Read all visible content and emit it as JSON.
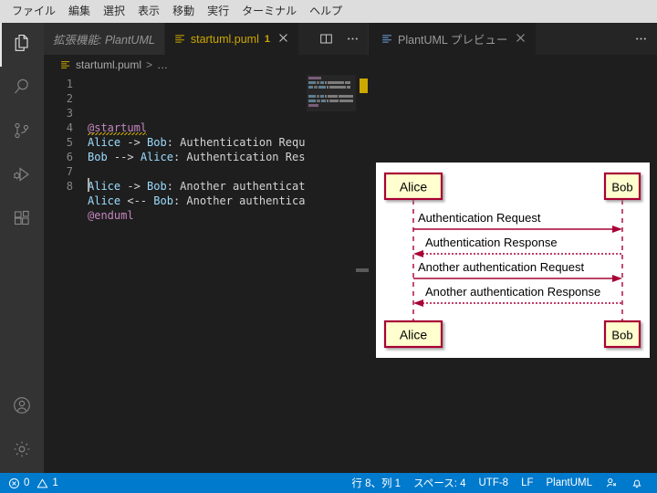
{
  "menu": {
    "items": [
      "ファイル",
      "編集",
      "選択",
      "表示",
      "移動",
      "実行",
      "ターミナル",
      "ヘルプ"
    ]
  },
  "activitybar": {
    "items": [
      {
        "name": "explorer",
        "icon": "files-icon",
        "active": true
      },
      {
        "name": "search",
        "icon": "search-icon",
        "active": false
      },
      {
        "name": "source-control",
        "icon": "source-control-icon",
        "active": false
      },
      {
        "name": "run-debug",
        "icon": "run-debug-icon",
        "active": false
      },
      {
        "name": "extensions",
        "icon": "extensions-icon",
        "active": false
      }
    ],
    "bottom": [
      {
        "name": "account",
        "icon": "account-icon"
      },
      {
        "name": "settings",
        "icon": "gear-icon"
      }
    ]
  },
  "editor_group_left": {
    "tabs": [
      {
        "label": "拡張機能: PlantUML",
        "icon": "extensions-tab-icon",
        "active": false,
        "italic": true,
        "badge": "",
        "closable": false
      },
      {
        "label": "startuml.puml",
        "icon": "file-lines-icon",
        "active": true,
        "italic": false,
        "badge": "1",
        "closable": true
      }
    ],
    "actions": [
      {
        "name": "split-editor-button",
        "icon": "split-editor-icon"
      },
      {
        "name": "more-actions-button",
        "icon": "ellipsis-icon"
      }
    ],
    "breadcrumb": {
      "file": "startuml.puml",
      "separator": ">",
      "tail": "…"
    }
  },
  "editor_group_right": {
    "tabs": [
      {
        "label": "PlantUML プレビュー",
        "icon": "file-lines-icon",
        "active": true,
        "italic": false,
        "badge": "",
        "closable": true
      }
    ],
    "actions": [
      {
        "name": "more-actions-button",
        "icon": "ellipsis-icon"
      }
    ]
  },
  "code": {
    "lines": [
      {
        "n": "1",
        "parts": [
          {
            "t": "@startuml",
            "c": "tok-pre",
            "squiggle": true
          }
        ]
      },
      {
        "n": "2",
        "parts": [
          {
            "t": "Alice",
            "c": "tok-part"
          },
          {
            "t": " -> ",
            "c": "tok-arrow"
          },
          {
            "t": "Bob",
            "c": "tok-part"
          },
          {
            "t": ": Authentication Requ",
            "c": "tok-msg"
          }
        ]
      },
      {
        "n": "3",
        "parts": [
          {
            "t": "Bob",
            "c": "tok-part"
          },
          {
            "t": " --> ",
            "c": "tok-arrow"
          },
          {
            "t": "Alice",
            "c": "tok-part"
          },
          {
            "t": ": Authentication Res",
            "c": "tok-msg"
          }
        ]
      },
      {
        "n": "4",
        "parts": []
      },
      {
        "n": "5",
        "parts": [
          {
            "t": "Alice",
            "c": "tok-part"
          },
          {
            "t": " -> ",
            "c": "tok-arrow"
          },
          {
            "t": "Bob",
            "c": "tok-part"
          },
          {
            "t": ": Another authenticat",
            "c": "tok-msg"
          }
        ]
      },
      {
        "n": "6",
        "parts": [
          {
            "t": "Alice",
            "c": "tok-part"
          },
          {
            "t": " <-- ",
            "c": "tok-arrow"
          },
          {
            "t": "Bob",
            "c": "tok-part"
          },
          {
            "t": ": Another authentica",
            "c": "tok-msg"
          }
        ]
      },
      {
        "n": "7",
        "parts": [
          {
            "t": "@enduml",
            "c": "tok-pre"
          }
        ]
      },
      {
        "n": "8",
        "parts": []
      }
    ],
    "full_source": "@startuml\nAlice -> Bob: Authentication Request\nBob --> Alice: Authentication Response\n\nAlice -> Bob: Another authentication Request\nAlice <-- Bob: Another authentication Response\n@enduml\n"
  },
  "diagram": {
    "type": "sequence",
    "participants": [
      "Alice",
      "Bob"
    ],
    "box_fill": "#FEFECE",
    "box_stroke": "#A80036",
    "line_color": "#A80036",
    "text_color": "#000000",
    "background": "#FFFFFF",
    "messages": [
      {
        "from": "Alice",
        "to": "Bob",
        "label": "Authentication Request",
        "style": "solid",
        "direction": "right"
      },
      {
        "from": "Bob",
        "to": "Alice",
        "label": "Authentication Response",
        "style": "dotted",
        "direction": "left"
      },
      {
        "from": "Alice",
        "to": "Bob",
        "label": "Another authentication Request",
        "style": "solid",
        "direction": "right"
      },
      {
        "from": "Bob",
        "to": "Alice",
        "label": "Another authentication Response",
        "style": "dotted",
        "direction": "left"
      }
    ]
  },
  "statusbar": {
    "problems": {
      "error_icon": "error-circle-icon",
      "errors": "0",
      "warning_icon": "warning-triangle-icon",
      "warnings": "1"
    },
    "right_items": [
      {
        "name": "cursor-position",
        "label": "行 8、列 1"
      },
      {
        "name": "indentation",
        "label": "スペース: 4"
      },
      {
        "name": "encoding",
        "label": "UTF-8"
      },
      {
        "name": "eol",
        "label": "LF"
      },
      {
        "name": "language-mode",
        "label": "PlantUML"
      }
    ],
    "right_icons": [
      {
        "name": "feedback-icon"
      },
      {
        "name": "bell-icon"
      }
    ]
  }
}
